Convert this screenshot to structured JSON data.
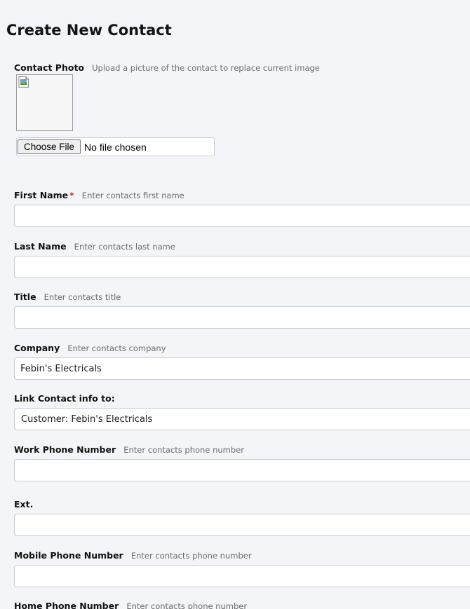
{
  "page": {
    "title": "Create New Contact"
  },
  "photo": {
    "label": "Contact Photo",
    "hint": "Upload a picture of the contact to replace current image",
    "choose_button": "Choose File",
    "file_status": "No file chosen"
  },
  "fields": {
    "first_name": {
      "label": "First Name",
      "required_mark": "*",
      "hint": "Enter contacts first name",
      "value": ""
    },
    "last_name": {
      "label": "Last Name",
      "hint": "Enter contacts last name",
      "value": ""
    },
    "title": {
      "label": "Title",
      "hint": "Enter contacts title",
      "value": ""
    },
    "company": {
      "label": "Company",
      "hint": "Enter contacts company",
      "value": "Febin's Electricals"
    },
    "link_contact": {
      "label": "Link Contact info to:",
      "selected": "Customer: Febin's Electricals"
    },
    "work_phone": {
      "label": "Work Phone Number",
      "hint": "Enter contacts phone number",
      "value": ""
    },
    "ext": {
      "label": "Ext.",
      "value": ""
    },
    "mobile_phone": {
      "label": "Mobile Phone Number",
      "hint": "Enter contacts phone number",
      "value": ""
    },
    "home_phone": {
      "label": "Home Phone Number",
      "hint": "Enter contacts phone number"
    }
  },
  "colors": {
    "background": "#f4f5f8",
    "input_border": "#c8cdd4",
    "required": "#c0392b",
    "hint_text": "#6b6b6b"
  },
  "icons": {
    "photo_placeholder": "broken-image-icon"
  }
}
